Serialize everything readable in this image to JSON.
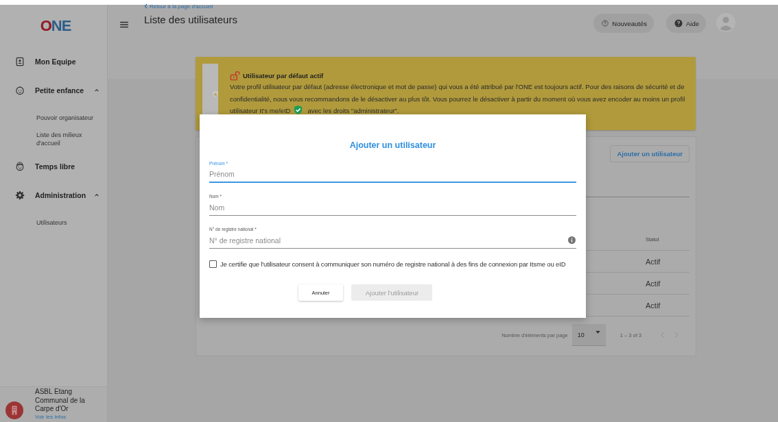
{
  "sidebar": {
    "logo": "ONE",
    "items": [
      {
        "label": "Mon Equipe"
      },
      {
        "label": "Petite enfance",
        "expanded": true,
        "children": [
          {
            "label": "Pouvoir organisateur"
          },
          {
            "label": "Liste des milieux d'accueil"
          }
        ]
      },
      {
        "label": "Temps libre"
      },
      {
        "label": "Administration",
        "expanded": true,
        "children": [
          {
            "label": "Utilisateurs"
          }
        ]
      }
    ],
    "organization": {
      "name": "ASBL Etang Communal de la Carpe d'Or",
      "link": "Voir les infos"
    }
  },
  "header": {
    "back_link": "Retour à la page d'accueil",
    "title": "Liste des utilisateurs",
    "buttons": [
      {
        "label": "Nouveautés",
        "kind": "news"
      },
      {
        "label": "Aide",
        "kind": "help"
      }
    ]
  },
  "banner": {
    "title": "Utilisateur par défaut actif",
    "text": "Votre profil utilisateur par défaut (adresse électronique et mot de passe) qui vous a été attribué par l'ONE est toujours actif. Pour des raisons de sécurité et de confidentialité, nous vous recommandons de le désactiver au plus tôt. Vous pourrez le désactiver à partir du moment où vous avez encoder au moins un profil utilisateur It's me/eID",
    "text_after": "avec les droits \"administrateur\"."
  },
  "users_card": {
    "add_button": "Ajouter un utilisateur",
    "table": {
      "columns": [
        "Statut"
      ],
      "rows": [
        [
          "Actif"
        ],
        [
          "Actif"
        ],
        [
          "Actif"
        ]
      ]
    },
    "pagination": {
      "label": "Nombre d'éléments par page",
      "page_size": "10",
      "range": "1 – 3 of 3"
    }
  },
  "dialog": {
    "title": "Ajouter un utilisateur",
    "fields": [
      {
        "label": "Prénom *",
        "placeholder": "Prénom",
        "focused": true
      },
      {
        "label": "Nom *",
        "placeholder": "Nom",
        "focused": false
      },
      {
        "label": "N° de registre national *",
        "placeholder": "N° de registre national",
        "focused": false,
        "info": true
      }
    ],
    "consent": {
      "label": "Je certifie que l'utilisateur consent à communiquer son numéro de registre national à des fins de connexion par Itsme ou eID",
      "checked": false
    },
    "buttons": [
      {
        "label": "Annuler",
        "disabled": false
      },
      {
        "label": "Ajouter l'utilisateur",
        "disabled": true
      }
    ]
  }
}
